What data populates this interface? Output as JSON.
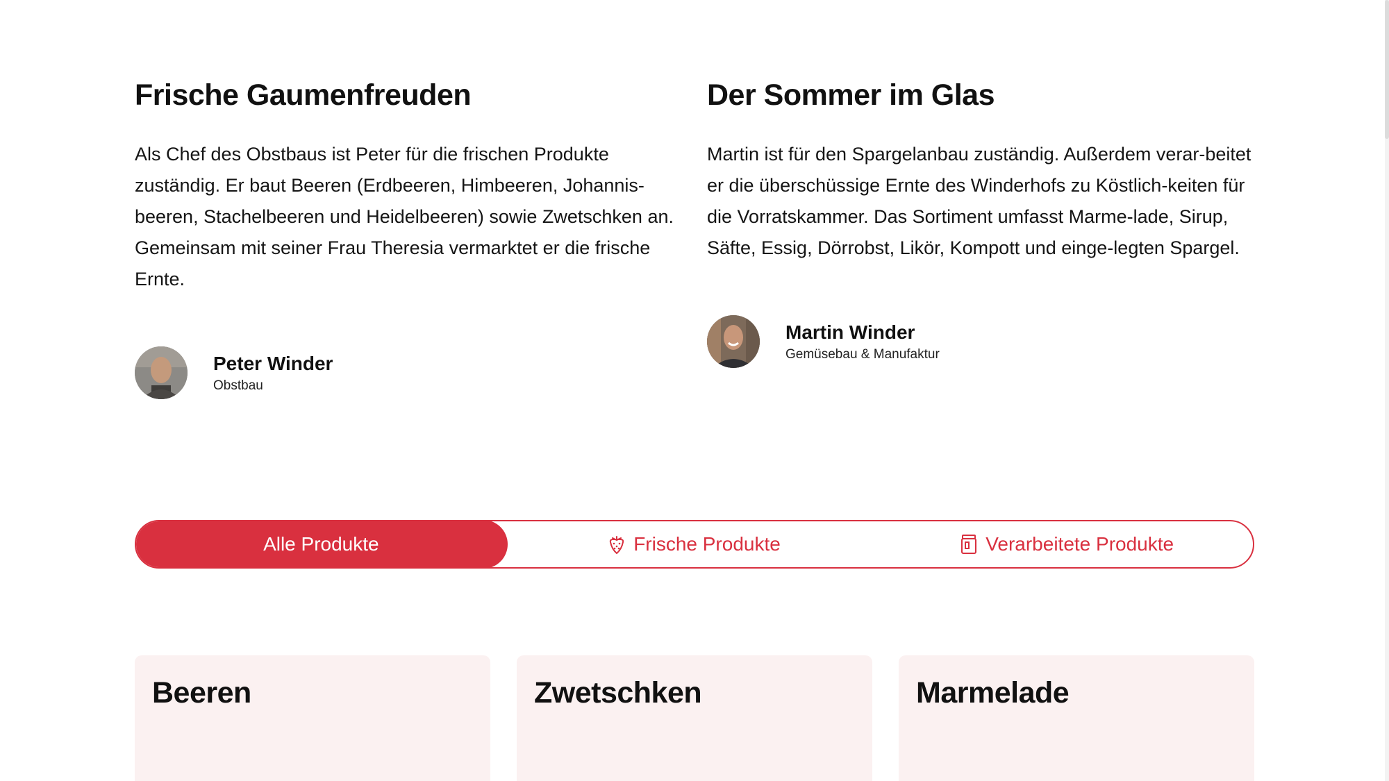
{
  "intro": {
    "left": {
      "title": "Frische Gaumenfreuden",
      "text": "Als Chef des Obstbaus ist Peter für die frischen Produkte zuständig. Er baut Beeren (Erdbeeren, Himbeeren, Johannis-beeren, Stachelbeeren und Heidelbeeren) sowie Zwetschken an. Gemeinsam mit seiner Frau Theresia vermarktet er die frische Ernte.",
      "person": {
        "name": "Peter Winder",
        "role": "Obstbau"
      }
    },
    "right": {
      "title": "Der Sommer im Glas",
      "text": "Martin ist für den Spargelanbau zuständig. Außerdem verar-beitet er die überschüssige Ernte des Winderhofs zu Köstlich-keiten für die Vorratskammer. Das Sortiment umfasst Marme-lade, Sirup, Säfte, Essig, Dörrobst, Likör, Kompott und einge-legten Spargel.",
      "person": {
        "name": "Martin Winder",
        "role": "Gemüsebau & Manufaktur"
      }
    }
  },
  "filter": {
    "tabs": [
      {
        "label": "Alle Produkte",
        "icon": "",
        "active": true
      },
      {
        "label": "Frische Produkte",
        "icon": "strawberry-icon",
        "active": false
      },
      {
        "label": "Verarbeitete Produkte",
        "icon": "jar-icon",
        "active": false
      }
    ]
  },
  "products": [
    {
      "title": "Beeren"
    },
    {
      "title": "Zwetschken"
    },
    {
      "title": "Marmelade"
    }
  ],
  "colors": {
    "accent": "#d9303f",
    "card_bg": "#fbf1f1",
    "text": "#111111"
  }
}
